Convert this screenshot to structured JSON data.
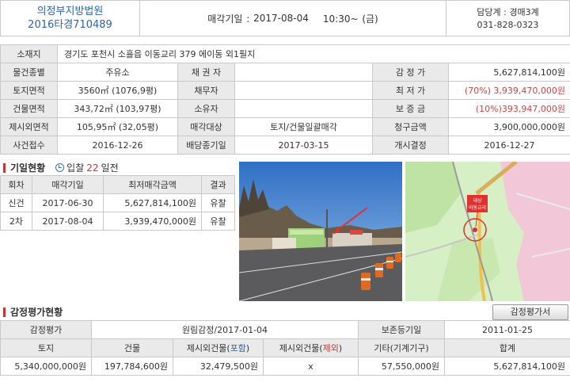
{
  "header": {
    "court": "의정부지방법원",
    "case_no": "2016타경710489",
    "sale_label": "매각기일 :",
    "sale_date": "2017-08-04",
    "sale_time": "10:30~ (금)",
    "dept_label": "담당계 : 경매3계",
    "phone": "031-828-0323"
  },
  "info": {
    "address_label": "소재지",
    "address": "경기도 포천시 소흘읍 이동교리 379 에이동 외1필지",
    "type_label": "물건종별",
    "type": "주유소",
    "creditor_label": "채 권 자",
    "creditor": "",
    "appraisal_label": "감 정 가",
    "appraisal": "5,627,814,100원",
    "land_label": "토지면적",
    "land_area": "3560㎡ (1076,9평)",
    "debtor_label": "채무자",
    "debtor": "",
    "min_label": "최 저 가",
    "min_price": "(70%) 3,939,470,000원",
    "bldg_label": "건물면적",
    "bldg_area": "343,72㎡ (103,97평)",
    "owner_label": "소유자",
    "owner": "",
    "deposit_label": "보 증 금",
    "deposit": "(10%)393,947,000원",
    "excl_label": "제시외면적",
    "excl_area": "105,95㎡ (32,05평)",
    "target_label": "매각대상",
    "target": "토지/건물일괄매각",
    "claim_label": "청구금액",
    "claim": "3,900,000,000원",
    "receipt_label": "사건접수",
    "receipt": "2016-12-26",
    "dividend_label": "배당종기일",
    "dividend": "2017-03-15",
    "start_label": "개시결정",
    "start": "2016-12-27"
  },
  "history": {
    "title": "기일현황",
    "days_prefix": "입찰",
    "days_num": "22",
    "days_suffix": "일전",
    "headers": [
      "회차",
      "매각기일",
      "최저매각금액",
      "결과"
    ],
    "rows": [
      {
        "round": "신건",
        "date": "2017-06-30",
        "price": "5,627,814,100원",
        "result": "유찰"
      },
      {
        "round": "2차",
        "date": "2017-08-04",
        "price": "3,939,470,000원",
        "result": "유찰"
      }
    ]
  },
  "map": {
    "marker_line1": "대상",
    "marker_line2": "이동교리"
  },
  "appraisal": {
    "title": "감정평가현황",
    "button": "감정평가서",
    "row1": {
      "label1": "감정평가",
      "value1": "원림감정/2017-01-04",
      "label2": "보존등기일",
      "value2": "2011-01-25"
    },
    "headers": {
      "land": "토지",
      "building": "건물",
      "incl_pre": "제시외건물(",
      "incl_hl": "포함",
      "incl_post": ")",
      "excl_pre": "제시외건물(",
      "excl_hl": "제외",
      "excl_post": ")",
      "machinery": "기타(기계기구)",
      "total": "합계"
    },
    "values": {
      "land": "5,340,000,000원",
      "building": "197,784,600원",
      "incl": "32,479,500원",
      "excl": "x",
      "machinery": "57,550,000원",
      "total": "5,627,814,100원"
    }
  },
  "colors": {
    "court_blue": "#2e63a8",
    "min_price_red": "#c44",
    "incl_blue": "#2e63a8",
    "excl_red": "#c33"
  }
}
